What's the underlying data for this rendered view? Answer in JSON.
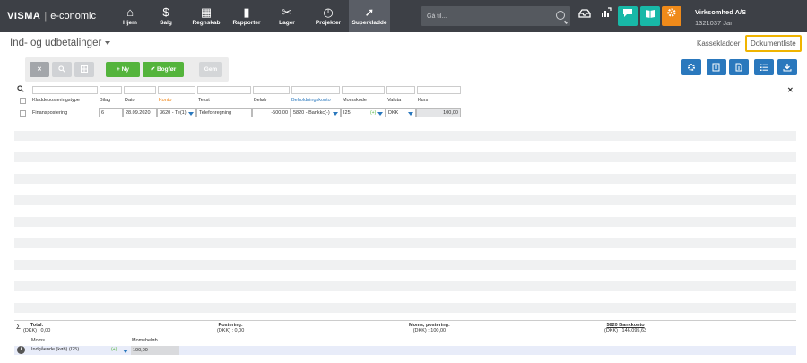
{
  "brand": {
    "wordmark": "VISMA",
    "app": "e-conomic"
  },
  "nav": [
    {
      "label": "Hjem",
      "icon": "home-icon",
      "glyph": "⌂"
    },
    {
      "label": "Salg",
      "icon": "dollar-icon",
      "glyph": "$"
    },
    {
      "label": "Regnskab",
      "icon": "calculator-icon",
      "glyph": "▦"
    },
    {
      "label": "Rapporter",
      "icon": "bar-chart-icon",
      "glyph": "▮"
    },
    {
      "label": "Lager",
      "icon": "tools-icon",
      "glyph": "✂"
    },
    {
      "label": "Projekter",
      "icon": "clock-icon",
      "glyph": "◷"
    },
    {
      "label": "Superkladde",
      "icon": "rocket-icon",
      "glyph": "➚"
    }
  ],
  "search": {
    "placeholder": "Gå til..."
  },
  "company": {
    "name": "Virksomhed A/S",
    "id": "1321037 Jan"
  },
  "page": {
    "title": "Ind- og udbetalinger"
  },
  "header_links": {
    "kassekladder": "Kassekladder",
    "dokumentliste": "Dokumentliste"
  },
  "toolbar": {
    "new_label": "Ny",
    "post_label": "Bogfør",
    "save_label": "Gem"
  },
  "columns": {
    "type": "Kladdeposteringstype",
    "bilag": "Bilag",
    "dato": "Dato",
    "konto": "Konto",
    "tekst": "Tekst",
    "beloeb": "Beløb",
    "beholdningskonto": "Beholdningskonto",
    "momskode": "Momskode",
    "valuta": "Valuta",
    "kurs": "Kurs"
  },
  "row": {
    "type": "Finanspostering",
    "bilag": "6",
    "dato": "28.09.2020",
    "konto": "3620 - Te(1)",
    "tekst": "Telefonregning",
    "beloeb": "-500,00",
    "beholdningskonto": "5820 - Bankkc(-)",
    "momskode": "I25",
    "momskode_tag": "(+)",
    "valuta": "DKK",
    "kurs": "100,00"
  },
  "totals": {
    "total_label": "Total:",
    "total_value": "(DKK) : 0,00",
    "postering_label": "Postering:",
    "postering_value": "(DKK) : 0,00",
    "moms_label": "Moms, postering:",
    "moms_value": "(DKK) : 100,00",
    "bank_label": "5820 Bankkonto",
    "bank_value": "(DKK) : 146.095,63"
  },
  "bottom": {
    "moms_header": "Moms",
    "momsbeloeb_header": "Momsbeløb",
    "moms_value": "Indgående (køb) (I25)",
    "moms_tag": "(+)",
    "momsbeloeb_value": "100,00"
  },
  "colors": {
    "nav_bg": "#3d4046",
    "accent_blue": "#2a78bd",
    "green": "#54b43c",
    "teal": "#18b8a7",
    "orange": "#ef8a1a",
    "highlight": "#f0b400"
  }
}
